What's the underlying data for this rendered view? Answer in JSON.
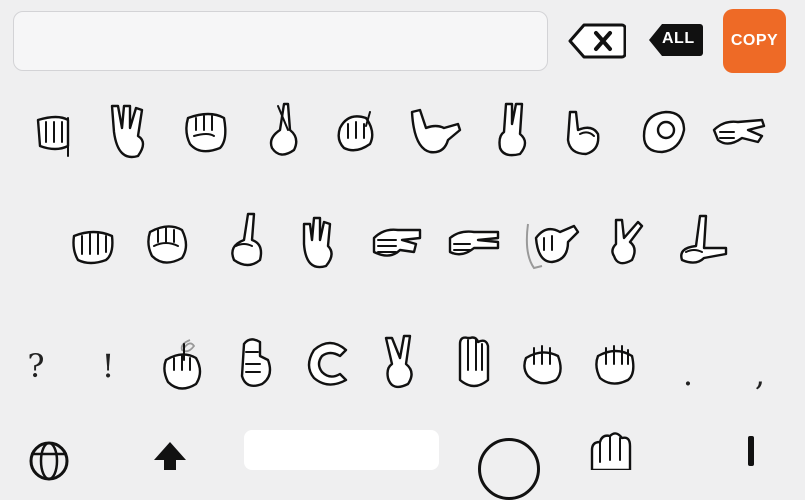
{
  "input": {
    "value": ""
  },
  "toolbar": {
    "backspace_icon": "backspace-icon",
    "all_label": "ALL",
    "copy_label": "COPY",
    "copy_color": "#ee6a26"
  },
  "keyboard": {
    "row1": [
      "sign-a-icon",
      "sign-w-icon",
      "sign-s-icon",
      "sign-r-icon",
      "sign-e-icon",
      "sign-y-icon",
      "sign-u-icon",
      "sign-i-icon",
      "sign-o-icon",
      "sign-p-icon"
    ],
    "row2": [
      "sign-a2-icon",
      "sign-s2-icon",
      "sign-d-icon",
      "sign-f-icon",
      "sign-g-icon",
      "sign-h-icon",
      "sign-j-icon",
      "sign-k-icon",
      "sign-l-icon"
    ],
    "row3_left": {
      "question": "?",
      "exclaim": "!"
    },
    "row3": [
      "sign-z-icon",
      "sign-x-icon",
      "sign-c-icon",
      "sign-v-icon",
      "sign-b-icon",
      "sign-n-icon",
      "sign-m-icon"
    ],
    "row3_right": {
      "period": ".",
      "comma": ","
    }
  },
  "bottom": {
    "globe_icon": "globe-icon",
    "shift_icon": "shift-icon",
    "space_label": ""
  }
}
